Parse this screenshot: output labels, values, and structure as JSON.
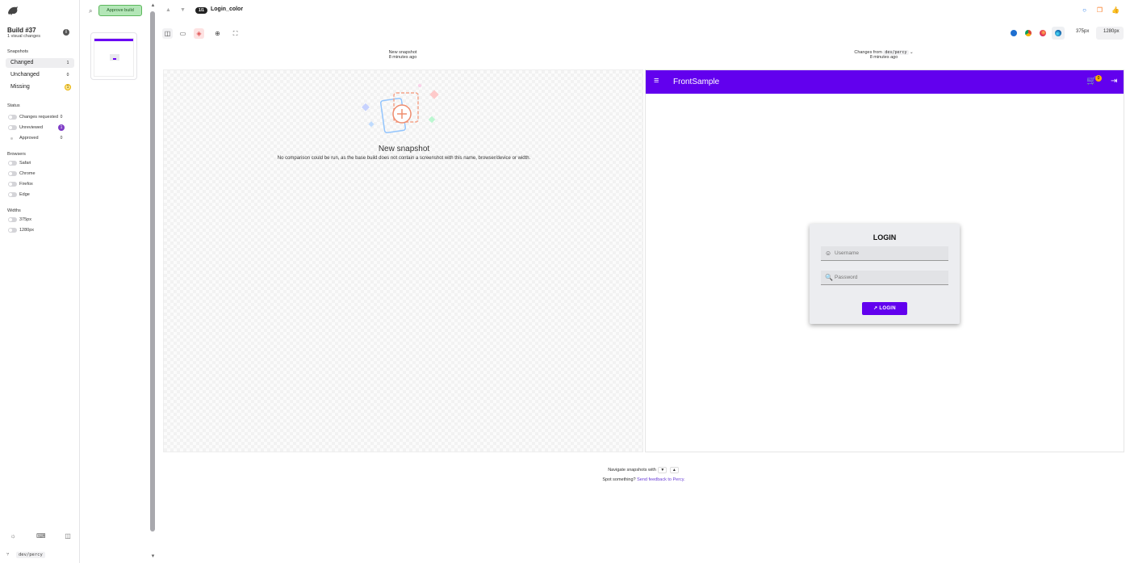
{
  "sidebar": {
    "build_title": "Build #37",
    "build_subtitle": "1 visual changes",
    "snapshots_label": "Snapshots",
    "snapshots": [
      {
        "label": "Changed",
        "count": "1"
      },
      {
        "label": "Unchanged",
        "count": "0"
      },
      {
        "label": "Missing",
        "count": "1"
      }
    ],
    "status_label": "Status",
    "status": [
      {
        "label": "Changes requested",
        "count": "0"
      },
      {
        "label": "Unreviewed",
        "count": "1"
      },
      {
        "label": "Approved",
        "count": "0"
      }
    ],
    "browsers_label": "Browsers",
    "browsers": [
      "Safari",
      "Chrome",
      "Firefox",
      "Edge"
    ],
    "widths_label": "Widths",
    "widths": [
      "375px",
      "1280px"
    ],
    "branch": "dev/percy"
  },
  "toolbar": {
    "approve_label": "Approve build",
    "snapshot_position": "1/1",
    "snapshot_name": "Login_color",
    "width_small": "375px",
    "width_large": "1280px"
  },
  "columns": {
    "left_title": "New snapshot",
    "left_time": "8 minutes ago",
    "right_title_prefix": "Changes from",
    "right_branch": "dev/percy",
    "right_time": "8 minutes ago"
  },
  "new_snapshot": {
    "title": "New snapshot",
    "description": "No comparison could be run, as the base build does not contain a screenshot with this name, browser/device or width."
  },
  "app": {
    "title": "FrontSample",
    "cart_count": "0",
    "login_title": "LOGIN",
    "username_placeholder": "Username",
    "password_placeholder": "Password",
    "login_button": "LOGIN"
  },
  "footer": {
    "navigate_text": "Navigate snapshots with",
    "key_down": "▼",
    "key_up": "▲",
    "feedback_prefix": "Spot something?",
    "feedback_link": "Send feedback to Percy."
  },
  "colors": {
    "brand": "#6200ee",
    "approve_bg": "#b3e6b7",
    "unreviewed": "#7e3cc6"
  }
}
